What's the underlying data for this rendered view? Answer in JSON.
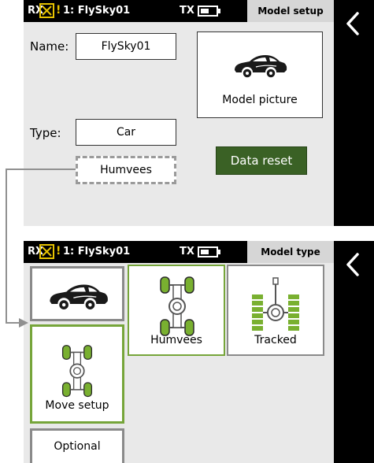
{
  "top_screen": {
    "status": {
      "rx_label": "RX",
      "warning": "!",
      "model_label": "1: FlySky01",
      "tx_label": "TX",
      "tx_battery_fraction": 0.55
    },
    "page_title": "Model setup",
    "name_label": "Name:",
    "name_value": "FlySky01",
    "model_picture_label": "Model picture",
    "type_label": "Type:",
    "type_value": "Car",
    "subtype_value": "Humvees",
    "data_reset_label": "Data reset"
  },
  "bottom_screen": {
    "status": {
      "rx_label": "RX",
      "warning": "!",
      "model_label": "1: FlySky01",
      "tx_label": "TX",
      "tx_battery_fraction": 0.55
    },
    "page_title": "Model type",
    "tiles": [
      {
        "label": "Humvees"
      },
      {
        "label": "Tracked"
      },
      {
        "label": "Move setup"
      },
      {
        "label": "Optional"
      }
    ]
  },
  "colors": {
    "accent_green": "#76a53a",
    "button_green": "#3a6125",
    "warning_yellow": "#e6c200",
    "connector_gray": "#909090",
    "screen_bg": "#e9e9e9"
  },
  "icons": [
    "rx-warning-x-icon",
    "back-chevron-icon",
    "car-icon",
    "humvee-chassis-icon",
    "tracked-chassis-icon",
    "tx-battery-icon"
  ]
}
